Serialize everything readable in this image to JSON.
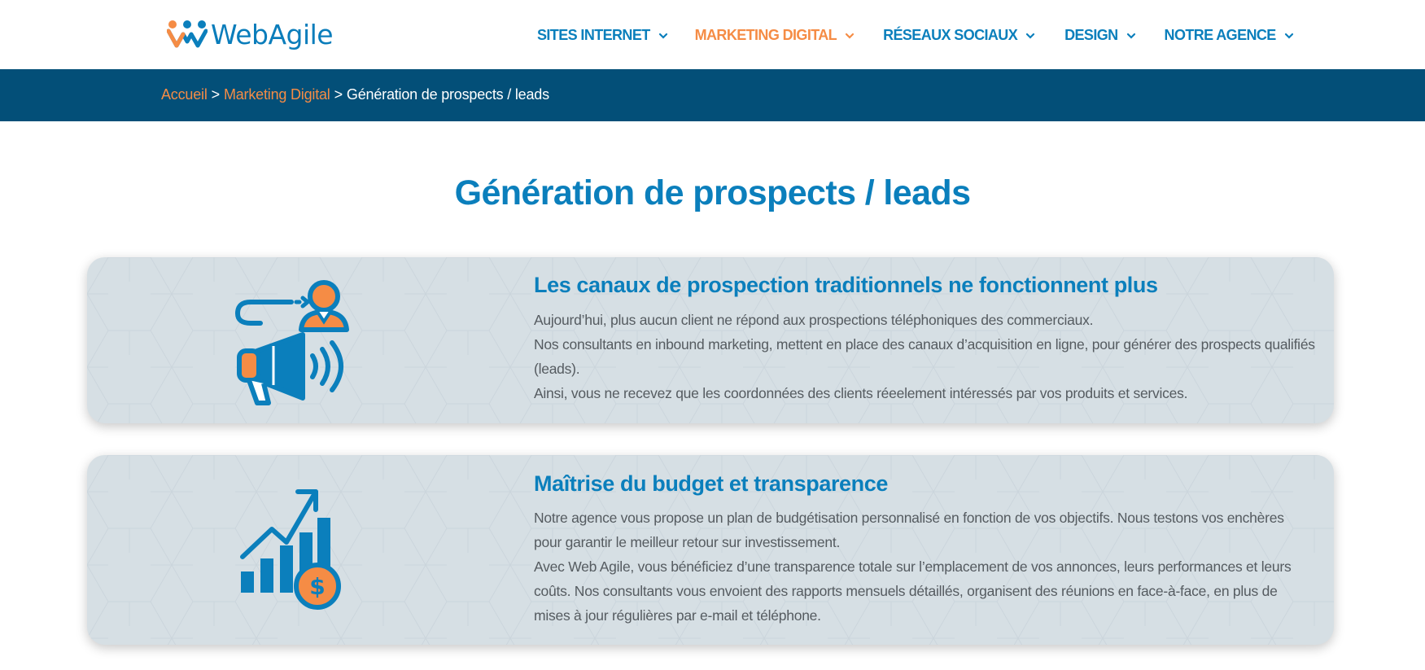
{
  "brand": {
    "name": "WebAgile",
    "colors": {
      "blue": "#0b7fbc",
      "orange": "#f58c45",
      "dark_blue": "#034f78"
    }
  },
  "nav": {
    "items": [
      {
        "label": "SITES INTERNET",
        "active": false
      },
      {
        "label": "MARKETING DIGITAL",
        "active": true
      },
      {
        "label": "RÉSEAUX SOCIAUX",
        "active": false
      },
      {
        "label": "DESIGN",
        "active": false
      },
      {
        "label": "NOTRE AGENCE",
        "active": false
      }
    ]
  },
  "breadcrumb": {
    "home": "Accueil",
    "section": "Marketing Digital",
    "separator": ">",
    "current": "Génération de prospects / leads"
  },
  "page": {
    "title": "Génération de prospects / leads"
  },
  "cards": [
    {
      "icon": "megaphone-prospect-icon",
      "title": "Les canaux de prospection traditionnels ne fonctionnent plus",
      "paragraphs": [
        "Aujourd’hui, plus aucun client ne répond aux prospections téléphoniques des commerciaux.",
        "Nos consultants en inbound marketing, mettent en place des canaux d’acquisition en ligne, pour générer des prospects qualifiés (leads).",
        "Ainsi, vous ne recevez que les coordonnées des clients réeelement intéressés par vos produits et services."
      ]
    },
    {
      "icon": "growth-budget-icon",
      "title": "Maîtrise du budget et transparence",
      "paragraphs": [
        "Notre agence vous propose un plan de budgétisation personnalisé en fonction de vos objectifs. Nous testons vos enchères pour garantir le meilleur retour sur investissement.",
        "Avec Web Agile, vous bénéficiez d’une transparence totale sur l’emplacement de vos annonces, leurs performances et leurs coûts. Nos consultants vous envoient des rapports mensuels détaillés, organisent des réunions en face-à-face, en plus de mises à jour régulières par e-mail et téléphone."
      ]
    }
  ]
}
